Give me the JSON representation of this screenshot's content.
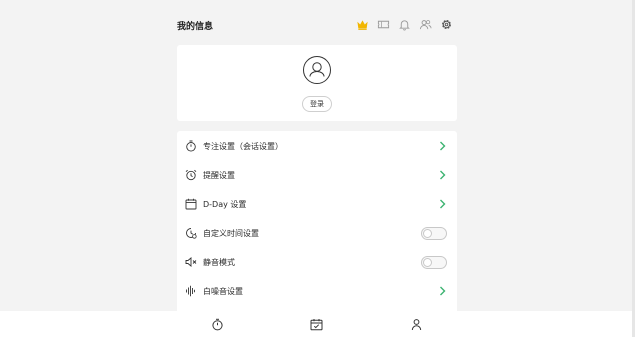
{
  "header": {
    "title": "我的信息",
    "icons": [
      "crown-icon",
      "ticket-icon",
      "bell-icon",
      "friends-icon",
      "gear-icon"
    ],
    "crown_color": "#f2b600"
  },
  "profile": {
    "login_label": "登录"
  },
  "settings": {
    "items": [
      {
        "label": "专注设置（会话设置）",
        "icon": "stopwatch-icon",
        "control": "chevron"
      },
      {
        "label": "提醒设置",
        "icon": "alarm-clock-icon",
        "control": "chevron"
      },
      {
        "label": "D-Day 设置",
        "icon": "calendar-icon",
        "control": "chevron"
      },
      {
        "label": "自定义时间设置",
        "icon": "custom-time-icon",
        "control": "toggle",
        "toggle_on": false
      },
      {
        "label": "静音模式",
        "icon": "mute-icon",
        "control": "toggle",
        "toggle_on": false
      },
      {
        "label": "白噪音设置",
        "icon": "sound-wave-icon",
        "control": "chevron"
      }
    ],
    "chevron_color": "#3cb371"
  },
  "tabbar": {
    "tabs": [
      "timer-tab-icon",
      "calendar-tab-icon",
      "profile-tab-icon"
    ]
  }
}
